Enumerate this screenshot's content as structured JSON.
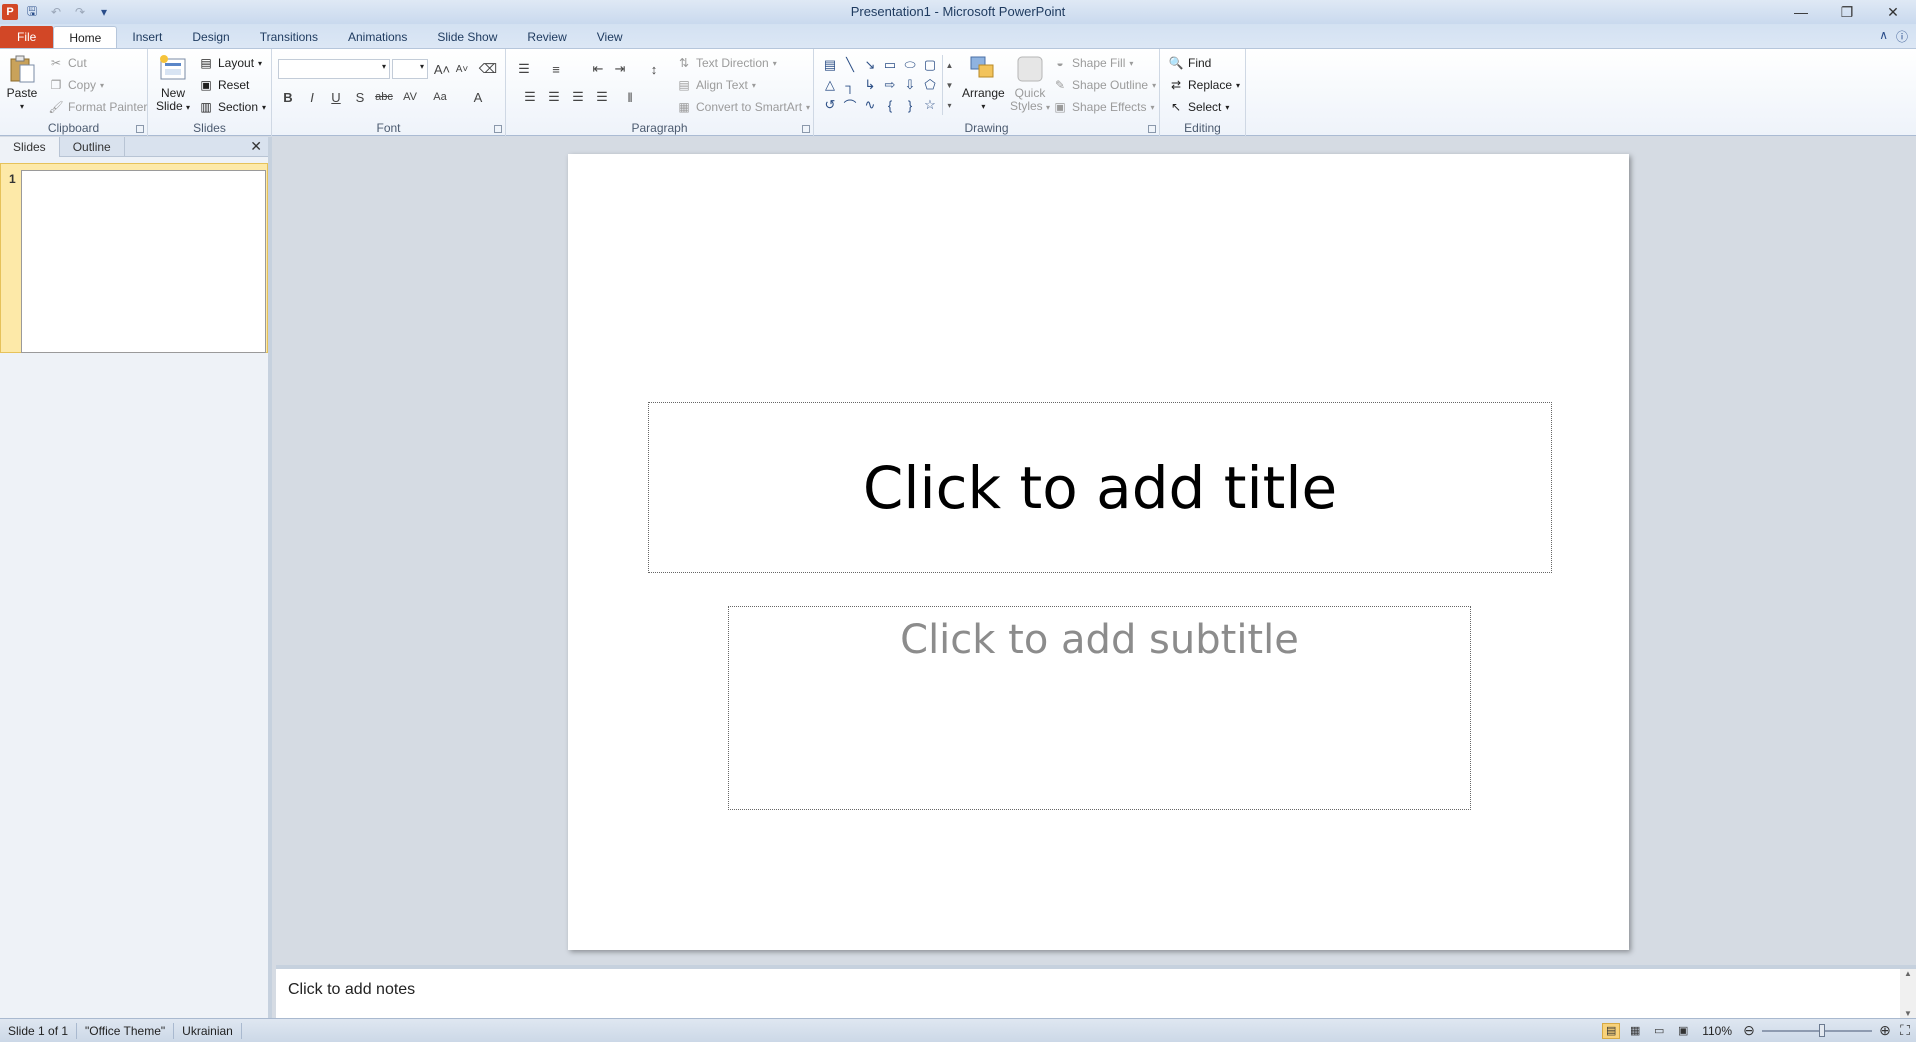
{
  "window": {
    "title": "Presentation1  -  Microsoft PowerPoint",
    "minimize_icon": "minimize-icon",
    "restore_icon": "restore-icon",
    "close_icon": "close-icon"
  },
  "qat": {
    "app_letter": "P",
    "icons": [
      "save-icon",
      "undo-icon",
      "redo-icon",
      "customize-qat-icon"
    ]
  },
  "tabs": [
    {
      "label": "File"
    },
    {
      "label": "Home"
    },
    {
      "label": "Insert"
    },
    {
      "label": "Design"
    },
    {
      "label": "Transitions"
    },
    {
      "label": "Animations"
    },
    {
      "label": "Slide Show"
    },
    {
      "label": "Review"
    },
    {
      "label": "View"
    }
  ],
  "ribbon": {
    "clipboard": {
      "label": "Clipboard",
      "paste": "Paste",
      "cut": "Cut",
      "copy": "Copy",
      "format_painter": "Format Painter"
    },
    "slides": {
      "label": "Slides",
      "new_slide_line1": "New",
      "new_slide_line2": "Slide",
      "layout": "Layout",
      "reset": "Reset",
      "section": "Section"
    },
    "font": {
      "label": "Font",
      "font_name": "",
      "font_size": ""
    },
    "paragraph": {
      "label": "Paragraph",
      "text_direction": "Text Direction",
      "align_text": "Align Text",
      "convert_smartart": "Convert to SmartArt"
    },
    "drawing": {
      "label": "Drawing",
      "arrange": "Arrange",
      "quick_styles_line1": "Quick",
      "quick_styles_line2": "Styles",
      "shape_fill": "Shape Fill",
      "shape_outline": "Shape Outline",
      "shape_effects": "Shape Effects"
    },
    "editing": {
      "label": "Editing",
      "find": "Find",
      "replace": "Replace",
      "select": "Select"
    }
  },
  "left_pane": {
    "tabs": [
      "Slides",
      "Outline"
    ],
    "active_tab": "Slides",
    "slides": [
      {
        "number": "1"
      }
    ]
  },
  "slide": {
    "title_placeholder": "Click to add title",
    "subtitle_placeholder": "Click to add subtitle"
  },
  "notes": {
    "placeholder": "Click to add notes"
  },
  "status": {
    "slide_info": "Slide 1 of 1",
    "theme": "\"Office Theme\"",
    "language": "Ukrainian",
    "zoom": "110%",
    "zoom_fraction": 0.55
  }
}
